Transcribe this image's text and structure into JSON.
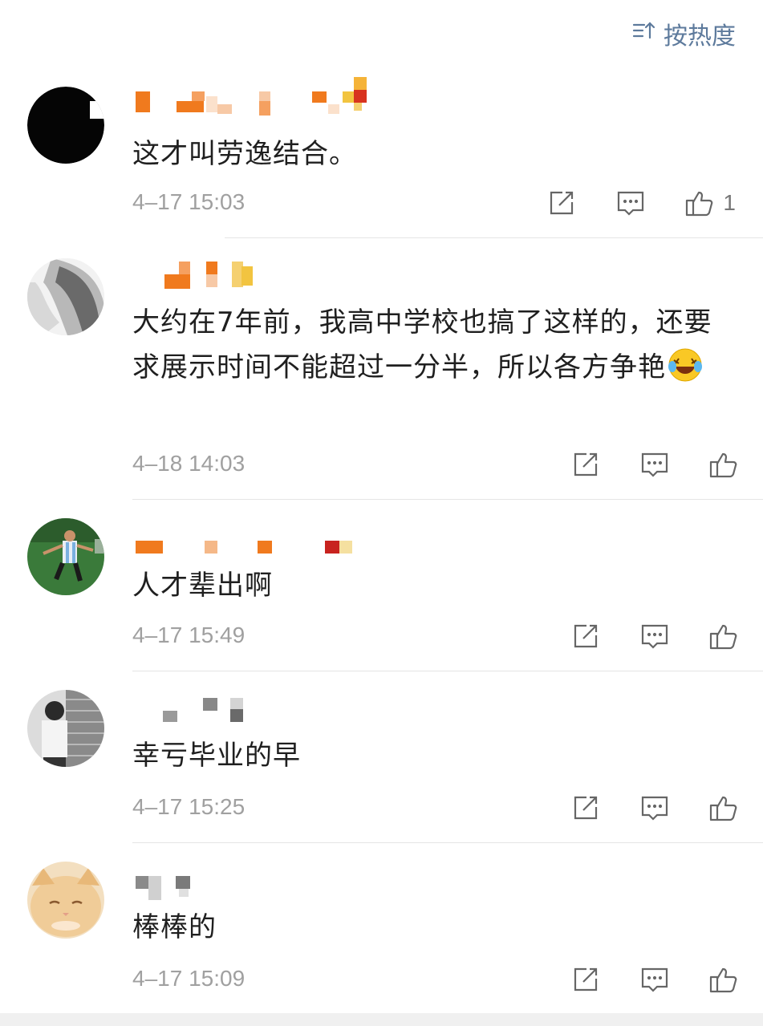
{
  "sort": {
    "label": "按热度",
    "icon": "sort-icon"
  },
  "comments": [
    {
      "content": "这才叫劳逸结合。",
      "time": "4–17 15:03",
      "likes": "1"
    },
    {
      "content": "大约在7年前，我高中学校也搞了这样的，还要求展示时间不能超过一分半，所以各方争艳",
      "emoji": "laugh-cry-emoji",
      "time": "4–18 14:03",
      "likes": ""
    },
    {
      "content": "人才辈出啊",
      "time": "4–17 15:49",
      "likes": ""
    },
    {
      "content": "幸亏毕业的早",
      "time": "4–17 15:25",
      "likes": ""
    },
    {
      "content": "棒棒的",
      "time": "4–17 15:09",
      "likes": ""
    }
  ],
  "icons": {
    "share": "share-icon",
    "reply": "comment-icon",
    "like": "thumbs-up-icon"
  },
  "colors": {
    "accent": "#5d7a9c",
    "time": "#a0a0a0",
    "name_orange": "#f07a1e"
  }
}
